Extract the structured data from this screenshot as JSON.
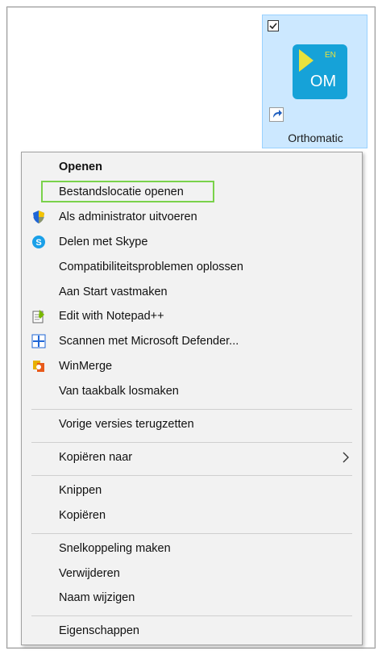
{
  "desktop_icon": {
    "label": "Orthomatic",
    "tile_badge": "EN",
    "tile_text": "OM",
    "tile_color": "#16a2d8",
    "accent_color": "#e8e23c",
    "selected": true
  },
  "context_menu": {
    "groups": [
      [
        {
          "label": "Openen",
          "bold": true,
          "icon": ""
        },
        {
          "label": "Bestandslocatie openen",
          "highlighted": true,
          "icon": ""
        },
        {
          "label": "Als administrator uitvoeren",
          "icon": "uac-shield-icon"
        },
        {
          "label": "Delen met Skype",
          "icon": "skype-icon"
        },
        {
          "label": "Compatibiliteitsproblemen oplossen",
          "icon": ""
        },
        {
          "label": "Aan Start vastmaken",
          "icon": ""
        },
        {
          "label": "Edit with Notepad++",
          "icon": "notepad-plus-plus-icon"
        },
        {
          "label": "Scannen met Microsoft Defender...",
          "icon": "defender-icon"
        },
        {
          "label": "WinMerge",
          "icon": "winmerge-icon"
        },
        {
          "label": "Van taakbalk losmaken",
          "icon": ""
        }
      ],
      [
        {
          "label": "Vorige versies terugzetten",
          "icon": ""
        }
      ],
      [
        {
          "label": "Kopiëren naar",
          "icon": "",
          "submenu": true
        }
      ],
      [
        {
          "label": "Knippen",
          "icon": ""
        },
        {
          "label": "Kopiëren",
          "icon": ""
        }
      ],
      [
        {
          "label": "Snelkoppeling maken",
          "icon": ""
        },
        {
          "label": "Verwijderen",
          "icon": ""
        },
        {
          "label": "Naam wijzigen",
          "icon": ""
        }
      ],
      [
        {
          "label": "Eigenschappen",
          "icon": ""
        }
      ]
    ],
    "highlight_color": "#7ad24b"
  }
}
